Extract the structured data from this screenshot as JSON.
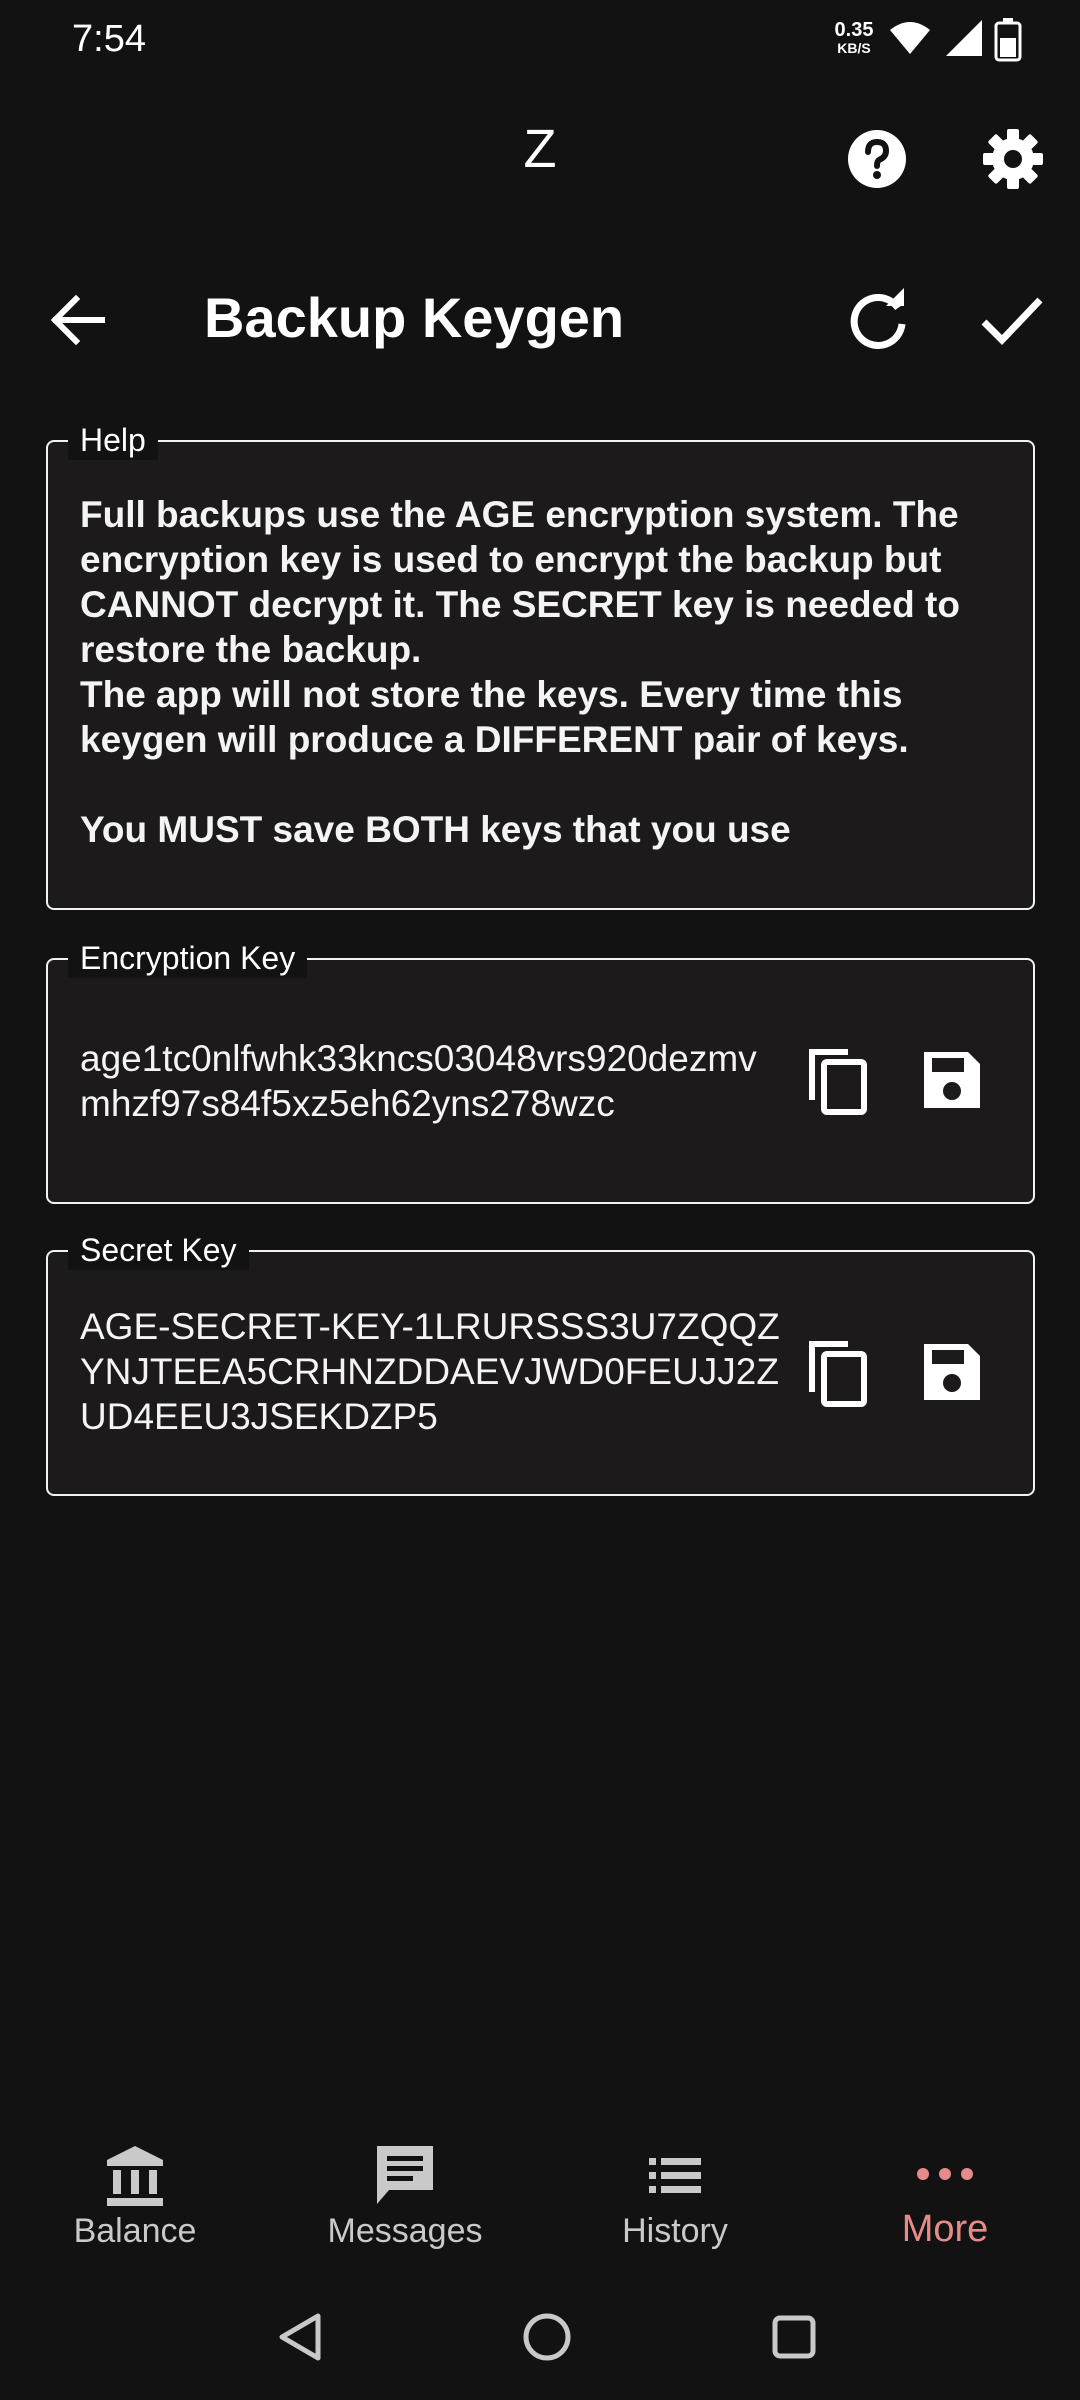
{
  "status_bar": {
    "time": "7:54",
    "speed_value": "0.35",
    "speed_unit": "KB/S",
    "icons": [
      "wifi-icon",
      "signal-icon",
      "battery-icon"
    ]
  },
  "app_bar": {
    "title": "Z",
    "icons": [
      "help-icon",
      "settings-icon"
    ]
  },
  "header": {
    "title": "Backup Keygen",
    "icons": [
      "back-arrow-icon",
      "refresh-icon",
      "check-icon"
    ]
  },
  "help": {
    "legend": "Help",
    "text": "Full backups use the AGE encryption system. The encryption key is used to encrypt the backup but CANNOT decrypt it. The SECRET key is needed to restore the backup.\nThe app will not store the keys. Every time this keygen will produce a DIFFERENT pair of keys.\n\nYou MUST save BOTH keys that you use"
  },
  "encryption_key": {
    "legend": "Encryption Key",
    "value": "age1tc0nlfwhk33kncs03048vrs920dezmvmhzf97s84f5xz5eh62yns278wzc",
    "icons": [
      "copy-icon",
      "save-icon"
    ]
  },
  "secret_key": {
    "legend": "Secret Key",
    "value": "AGE-SECRET-KEY-1LRURSSS3U7ZQQZYNJTEEA5CRHNZDDAEVJWD0FEUJJ2ZUD4EEU3JSEKDZP5",
    "icons": [
      "copy-icon",
      "save-icon"
    ]
  },
  "bottom_nav": {
    "items": [
      {
        "label": "Balance",
        "icon": "bank-icon"
      },
      {
        "label": "Messages",
        "icon": "message-icon"
      },
      {
        "label": "History",
        "icon": "list-icon"
      },
      {
        "label": "More",
        "icon": "more-dots-icon",
        "active": true
      }
    ]
  },
  "colors": {
    "background": "#121212",
    "card_background": "#1c1a1a",
    "active_nav": "#e88a8a",
    "text": "#ffffff"
  }
}
